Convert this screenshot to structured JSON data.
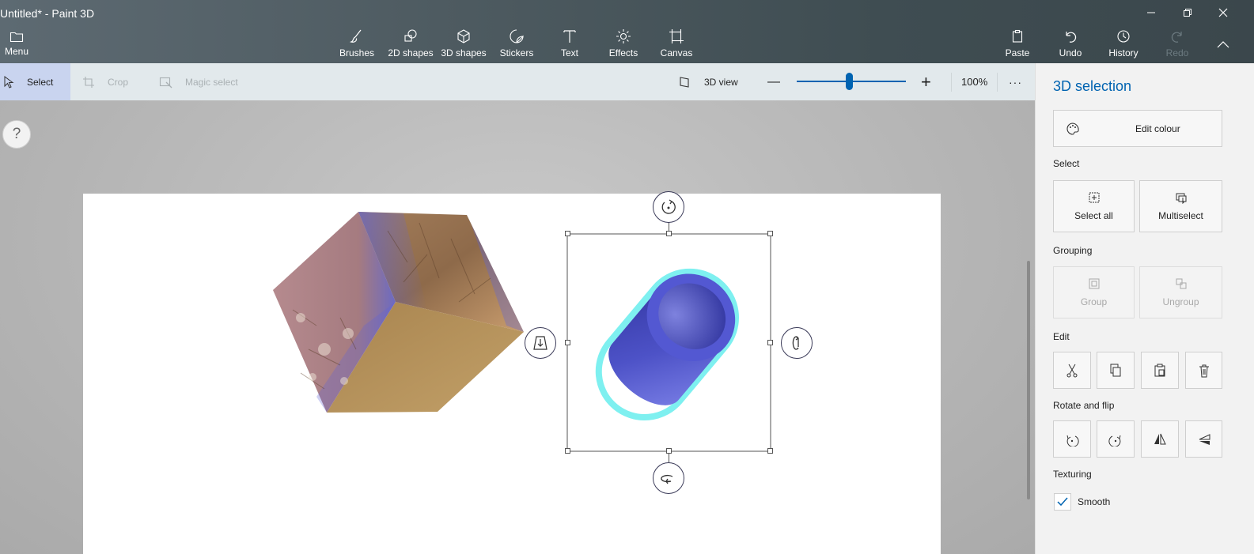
{
  "window": {
    "title": "Untitled* - Paint 3D"
  },
  "menu": {
    "label": "Menu"
  },
  "tools": [
    {
      "label": "Brushes",
      "icon": "brush-icon"
    },
    {
      "label": "2D shapes",
      "icon": "2d-shapes-icon"
    },
    {
      "label": "3D shapes",
      "icon": "3d-shapes-icon"
    },
    {
      "label": "Stickers",
      "icon": "stickers-icon"
    },
    {
      "label": "Text",
      "icon": "text-icon"
    },
    {
      "label": "Effects",
      "icon": "effects-icon"
    },
    {
      "label": "Canvas",
      "icon": "canvas-icon"
    }
  ],
  "actions": {
    "paste": "Paste",
    "undo": "Undo",
    "history": "History",
    "redo": "Redo"
  },
  "toolbar": {
    "select": "Select",
    "crop": "Crop",
    "magic_select": "Magic select",
    "view3d": "3D view",
    "zoom_minus": "—",
    "zoom_plus": "+",
    "zoom_value": "100%",
    "zoom_level": 0.48,
    "more": "···"
  },
  "help": {
    "label": "?"
  },
  "panel": {
    "title": "3D selection",
    "edit_colour": "Edit colour",
    "select_heading": "Select",
    "select_all": "Select all",
    "multiselect": "Multiselect",
    "grouping_heading": "Grouping",
    "group": "Group",
    "ungroup": "Ungroup",
    "edit_heading": "Edit",
    "rotate_heading": "Rotate and flip",
    "texturing_heading": "Texturing",
    "smooth": "Smooth",
    "smooth_checked": true
  },
  "colors": {
    "accent": "#0063b1",
    "selection_glow": "#7ef0f0",
    "cylinder": "#5a5fd0"
  }
}
